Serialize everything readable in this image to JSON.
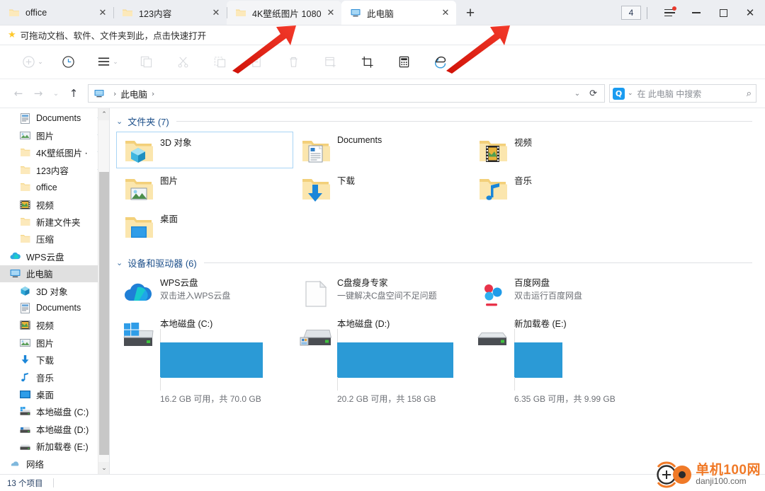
{
  "window": {
    "tab_count_badge": "4",
    "tabs": [
      {
        "label": "office",
        "icon": "folder-icon",
        "state": "normal"
      },
      {
        "label": "123内容",
        "icon": "folder-icon",
        "state": "normal"
      },
      {
        "label": "4K壁纸图片 1080",
        "icon": "folder-icon",
        "state": "hover"
      },
      {
        "label": "此电脑",
        "icon": "this-pc-icon",
        "state": "active"
      }
    ],
    "new_tab_label": "+",
    "close_label": "✕",
    "controls": {
      "minimize": "—",
      "maximize": "□",
      "close": "✕"
    }
  },
  "favbar": {
    "star": "★",
    "text": "可拖动文档、软件、文件夹到此，点击快速打开"
  },
  "toolbar": {
    "items": [
      {
        "name": "new-item-button",
        "icon": "plus-circle-icon",
        "has_chevron": true,
        "enabled": false
      },
      {
        "name": "history-button",
        "icon": "clock-icon",
        "enabled": true
      },
      {
        "name": "view-menu-button",
        "icon": "list-lines-icon",
        "has_chevron": true,
        "enabled": true
      },
      {
        "name": "copy-button",
        "icon": "copy-icon",
        "enabled": false
      },
      {
        "name": "cut-button",
        "icon": "scissors-icon",
        "enabled": false
      },
      {
        "name": "paste-button",
        "icon": "paste-icon",
        "enabled": false
      },
      {
        "name": "rename-button",
        "icon": "rename-icon",
        "enabled": false
      },
      {
        "name": "delete-button",
        "icon": "trash-icon",
        "enabled": false
      },
      {
        "name": "new-folder-button",
        "icon": "new-folder-icon",
        "enabled": false
      },
      {
        "name": "screenshot-button",
        "icon": "crop-icon",
        "enabled": true
      },
      {
        "name": "calculator-button",
        "icon": "calculator-icon",
        "enabled": true
      },
      {
        "name": "browser-button",
        "icon": "edge-swirl-icon",
        "enabled": true
      }
    ]
  },
  "address": {
    "back": "←",
    "forward": "→",
    "recent": "⌄",
    "up": "↑",
    "crumb_icon": "this-pc-icon",
    "crumb": "此电脑",
    "crumb_sep": "›",
    "dropdown_chevron": "⌄",
    "refresh": "⟳",
    "search": {
      "q_badge": "Q",
      "q_chevron": "⌄",
      "placeholder": "在 此电脑 中搜索",
      "magnifier": "⌕"
    }
  },
  "sidebar": {
    "items": [
      {
        "label": "Documents",
        "icon": "documents-icon",
        "pinned": true,
        "selected": false
      },
      {
        "label": "图片",
        "icon": "pictures-icon",
        "pinned": true,
        "selected": false
      },
      {
        "label": "4K壁纸图片 ⋅",
        "icon": "folder-icon",
        "pinned": true,
        "selected": false
      },
      {
        "label": "123内容",
        "icon": "folder-icon",
        "pinned": true,
        "selected": false
      },
      {
        "label": "office",
        "icon": "folder-icon",
        "pinned": false,
        "selected": false
      },
      {
        "label": "视频",
        "icon": "videos-icon",
        "pinned": false,
        "selected": false
      },
      {
        "label": "新建文件夹",
        "icon": "folder-icon",
        "pinned": false,
        "selected": false
      },
      {
        "label": "压缩",
        "icon": "folder-icon",
        "pinned": false,
        "selected": false
      },
      {
        "label": "WPS云盘",
        "icon": "wps-cloud-icon",
        "pinned": false,
        "selected": false,
        "indent": 0
      },
      {
        "label": "此电脑",
        "icon": "this-pc-icon",
        "pinned": false,
        "selected": true,
        "indent": 0
      },
      {
        "label": "3D 对象",
        "icon": "3d-objects-icon",
        "pinned": false,
        "selected": false,
        "indent": 1
      },
      {
        "label": "Documents",
        "icon": "documents-icon",
        "pinned": false,
        "selected": false,
        "indent": 1
      },
      {
        "label": "视频",
        "icon": "videos-icon",
        "pinned": false,
        "selected": false,
        "indent": 1
      },
      {
        "label": "图片",
        "icon": "pictures-icon",
        "pinned": false,
        "selected": false,
        "indent": 1
      },
      {
        "label": "下载",
        "icon": "downloads-icon",
        "pinned": false,
        "selected": false,
        "indent": 1
      },
      {
        "label": "音乐",
        "icon": "music-icon",
        "pinned": false,
        "selected": false,
        "indent": 1
      },
      {
        "label": "桌面",
        "icon": "desktop-icon",
        "pinned": false,
        "selected": false,
        "indent": 1
      },
      {
        "label": "本地磁盘 (C:)",
        "icon": "drive-windows-icon",
        "pinned": false,
        "selected": false,
        "indent": 1
      },
      {
        "label": "本地磁盘 (D:)",
        "icon": "drive-icon",
        "pinned": false,
        "selected": false,
        "indent": 1
      },
      {
        "label": "新加载卷 (E:)",
        "icon": "drive-icon",
        "pinned": false,
        "selected": false,
        "indent": 1
      },
      {
        "label": "网络",
        "icon": "network-icon",
        "pinned": false,
        "selected": false,
        "indent": 0
      }
    ],
    "scroll_up": "⌃",
    "scroll_down": "⌄"
  },
  "content": {
    "groups": [
      {
        "title": "文件夹 (7)",
        "chevron": "⌄",
        "items": [
          {
            "name": "3D 对象",
            "icon": "folder-3d-icon",
            "selected": true
          },
          {
            "name": "Documents",
            "icon": "folder-documents-icon",
            "selected": false
          },
          {
            "name": "视频",
            "icon": "folder-videos-icon",
            "selected": false
          },
          {
            "name": "图片",
            "icon": "folder-pictures-icon",
            "selected": false
          },
          {
            "name": "下载",
            "icon": "folder-downloads-icon",
            "selected": false
          },
          {
            "name": "音乐",
            "icon": "folder-music-icon",
            "selected": false
          },
          {
            "name": "桌面",
            "icon": "folder-desktop-icon",
            "selected": false
          }
        ]
      }
    ],
    "drives_group": {
      "title": "设备和驱动器 (6)",
      "chevron": "⌄",
      "items": [
        {
          "name": "WPS云盘",
          "sub": "双击进入WPS云盘",
          "icon": "wps-cloud-icon",
          "kind": "app"
        },
        {
          "name": "C盘瘦身专家",
          "sub": "一键解决C盘空间不足问题",
          "icon": "blank-doc-icon",
          "kind": "app"
        },
        {
          "name": "百度网盘",
          "sub": "双击运行百度网盘",
          "icon": "baidu-pan-icon",
          "kind": "app"
        },
        {
          "name": "本地磁盘 (C:)",
          "icon": "drive-windows-icon",
          "kind": "drive",
          "free": "16.2 GB 可用，共 70.0 GB",
          "used_pct": 77
        },
        {
          "name": "本地磁盘 (D:)",
          "icon": "drive-shared-icon",
          "kind": "drive",
          "free": "20.2 GB 可用，共 158 GB",
          "used_pct": 87
        },
        {
          "name": "新加载卷 (E:)",
          "icon": "drive-icon",
          "kind": "drive",
          "free": "6.35 GB 可用，共 9.99 GB",
          "used_pct": 36
        }
      ]
    }
  },
  "statusbar": {
    "items_count": "13 个项目"
  },
  "watermark": {
    "top": "单机100网",
    "bottom": "danji100.com"
  },
  "colors": {
    "accent_blue": "#2b9ad6",
    "group_title": "#1c4f8a",
    "folder_yellow": "#f7d98a",
    "selection_border": "#a8d4f5",
    "arrow_red": "#e8251b",
    "watermark_orange": "#f07a28"
  }
}
